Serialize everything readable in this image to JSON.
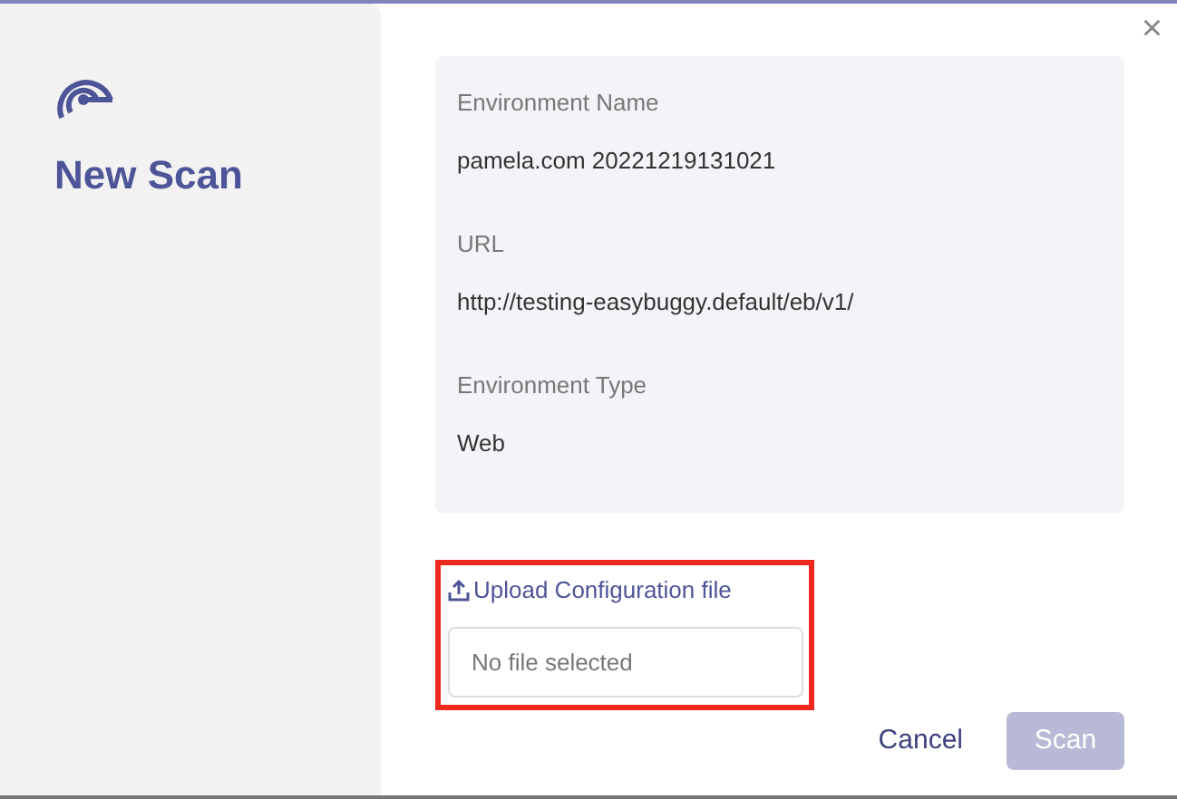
{
  "sidebar": {
    "title": "New Scan"
  },
  "close": "×",
  "details": [
    {
      "label": "Environment Name",
      "value": "pamela.com 20221219131021"
    },
    {
      "label": "URL",
      "value": "http://testing-easybuggy.default/eb/v1/"
    },
    {
      "label": "Environment Type",
      "value": "Web"
    }
  ],
  "upload": {
    "link": "Upload Configuration file",
    "placeholder": "No file selected",
    "highlighted": true
  },
  "buttons": [
    {
      "label": "Cancel",
      "kind": "link"
    },
    {
      "label": "Scan",
      "kind": "primary",
      "disabled": true
    }
  ]
}
